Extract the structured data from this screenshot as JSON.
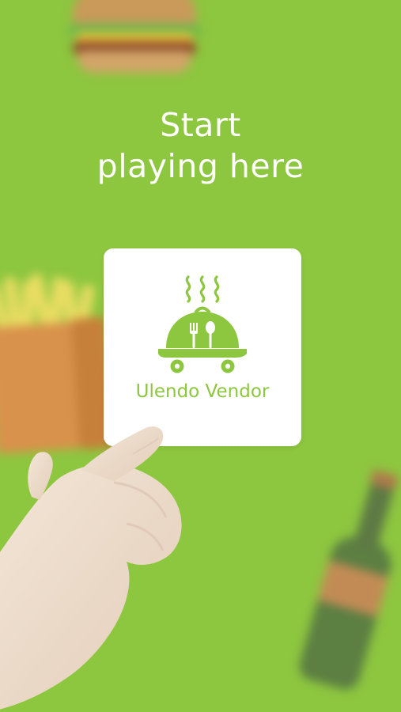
{
  "screen": {
    "background_color": "#8dc63f"
  },
  "headline": {
    "line1": "Start",
    "line2": "playing here"
  },
  "app_card": {
    "name": "Ulendo Vendor",
    "accent_color": "#8dc63f",
    "icon": "food-cloche-cart-icon"
  },
  "decorations": {
    "burger": "burger-image",
    "fries": "fries-image",
    "bottle": "bottle-image",
    "hand": "pointing-hand-image"
  }
}
